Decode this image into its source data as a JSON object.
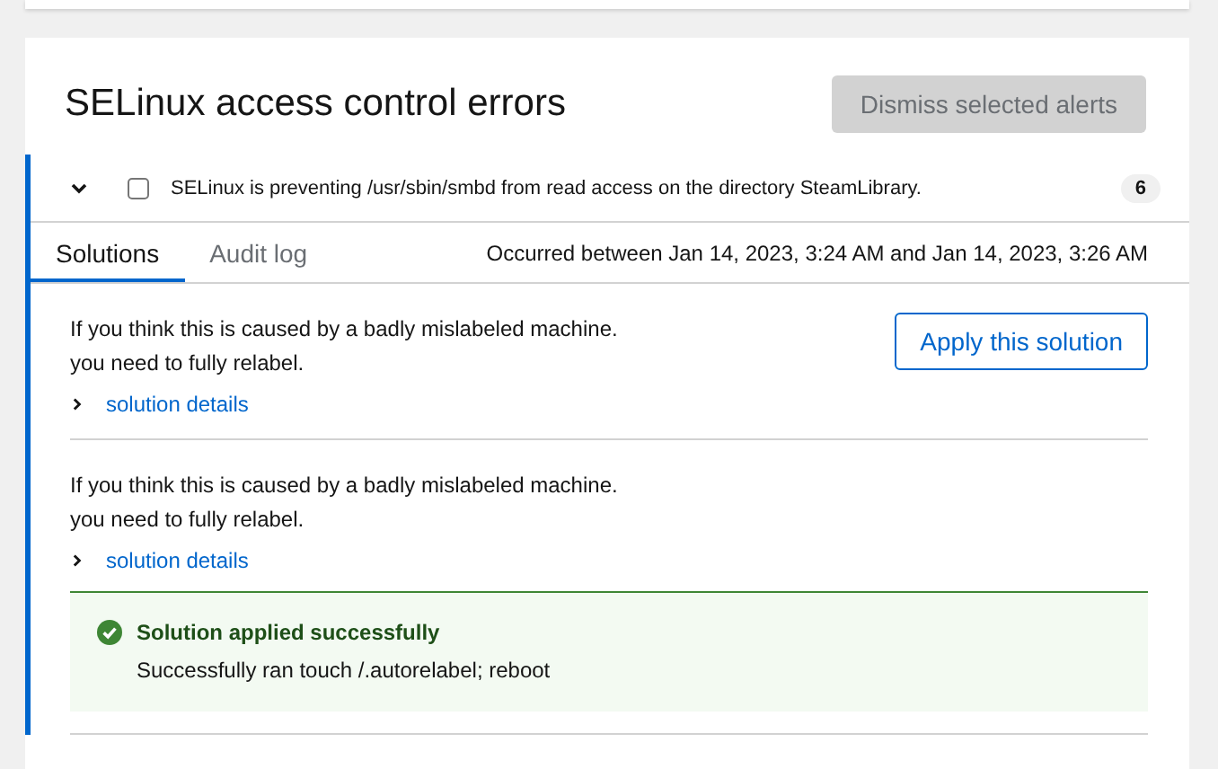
{
  "title": "SELinux access control errors",
  "dismiss_button": {
    "label": "Dismiss selected alerts",
    "disabled": true
  },
  "alert": {
    "expanded": true,
    "checked": false,
    "message": "SELinux is preventing /usr/sbin/smbd from read access on the directory SteamLibrary.",
    "count": "6"
  },
  "tabs": [
    {
      "label": "Solutions",
      "selected": true
    },
    {
      "label": "Audit log",
      "selected": false
    }
  ],
  "occurred": "Occurred between Jan 14, 2023, 3:24 AM and Jan 14, 2023, 3:26 AM",
  "solutions": [
    {
      "kind": "applicable",
      "lines": [
        "If you think this is caused by a badly mislabeled machine.",
        "you need to fully relabel."
      ],
      "details_label": "solution details",
      "details_expanded": false,
      "button": "Apply this solution"
    },
    {
      "kind": "applied",
      "lines": [
        "If you think this is caused by a badly mislabeled machine.",
        "you need to fully relabel."
      ],
      "details_label": "solution details",
      "details_expanded": false,
      "result": {
        "title": "Solution applied successfully",
        "message": "Successfully ran touch /.autorelabel; reboot"
      }
    }
  ]
}
